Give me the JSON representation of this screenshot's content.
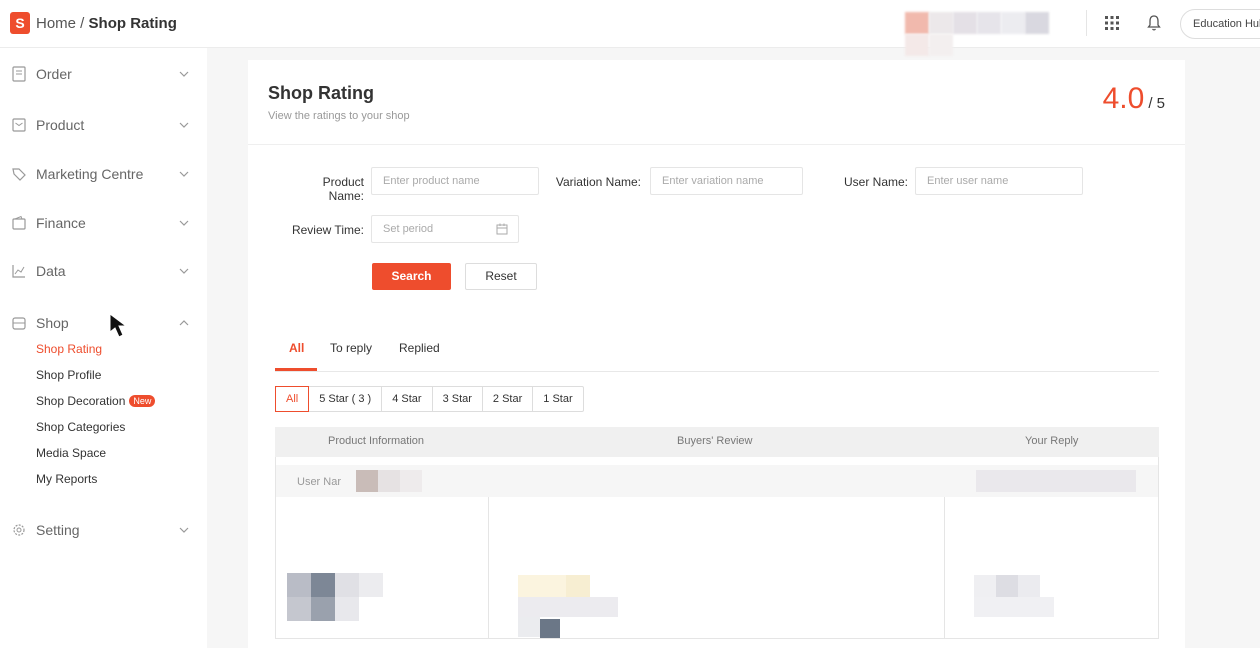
{
  "topbar": {
    "logo_letter": "S",
    "breadcrumb_home": "Home",
    "breadcrumb_sep": " / ",
    "breadcrumb_current": "Shop Rating",
    "account_button": "Education Hub"
  },
  "sidebar": {
    "items": [
      {
        "label": "Order",
        "icon": "order-icon"
      },
      {
        "label": "Product",
        "icon": "product-icon"
      },
      {
        "label": "Marketing Centre",
        "icon": "tag-icon"
      },
      {
        "label": "Finance",
        "icon": "wallet-icon"
      },
      {
        "label": "Data",
        "icon": "chart-icon"
      },
      {
        "label": "Shop",
        "icon": "shop-icon"
      },
      {
        "label": "Setting",
        "icon": "gear-icon"
      }
    ],
    "shop_sub": [
      {
        "label": "Shop Rating"
      },
      {
        "label": "Shop Profile"
      },
      {
        "label": "Shop Decoration"
      },
      {
        "label": "Shop Categories"
      },
      {
        "label": "Media Space"
      },
      {
        "label": "My Reports"
      }
    ],
    "new_badge": "New"
  },
  "main": {
    "title": "Shop Rating",
    "subtitle": "View the ratings to your shop",
    "score": "4.0",
    "score_max": "/ 5",
    "filters": {
      "product_name_label": "Product Name:",
      "product_name_placeholder": "Enter product name",
      "variation_name_label": "Variation Name:",
      "variation_name_placeholder": "Enter variation name",
      "user_name_label": "User Name:",
      "user_name_placeholder": "Enter user name",
      "review_time_label": "Review Time:",
      "review_time_placeholder": "Set period"
    },
    "buttons": {
      "search": "Search",
      "reset": "Reset"
    },
    "tabs": [
      "All",
      "To reply",
      "Replied"
    ],
    "star_filters": [
      "All",
      "5 Star ( 3 )",
      "4 Star",
      "3 Star",
      "2 Star",
      "1 Star"
    ],
    "table": {
      "columns": [
        "Product Information",
        "Buyers' Review",
        "Your Reply"
      ],
      "user_label": "User Nar"
    }
  },
  "colors": {
    "accent": "#ee4d2d"
  }
}
